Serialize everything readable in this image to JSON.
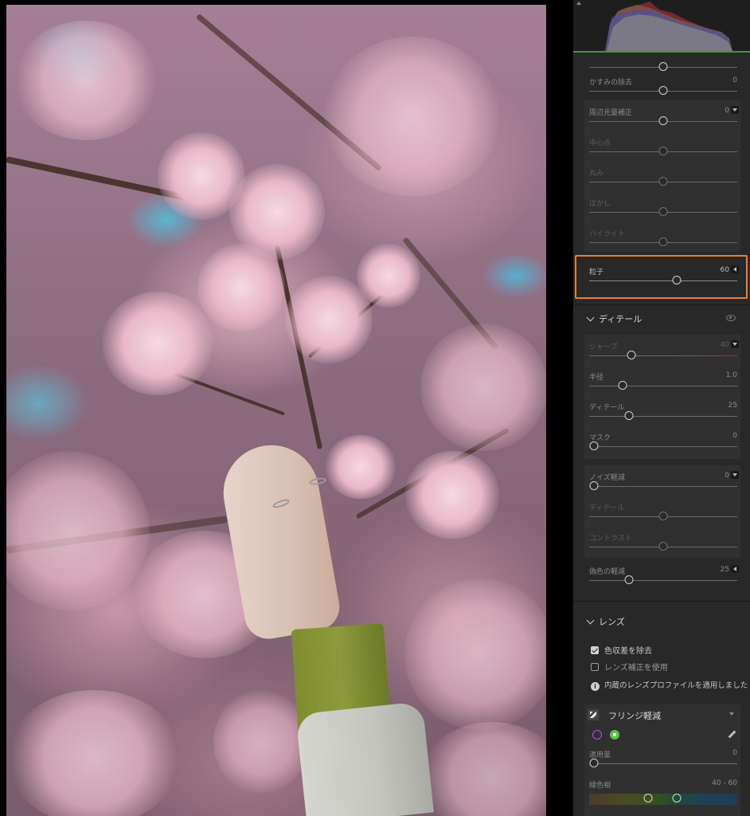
{
  "panel": {
    "sections": {
      "dehaze": {
        "label": "かすみの除去",
        "value": "0"
      },
      "vignette": {
        "label": "周辺光量補正",
        "value": "0",
        "sub": [
          {
            "label": "中心点"
          },
          {
            "label": "丸み"
          },
          {
            "label": "ぼかし"
          },
          {
            "label": "ハイライト"
          }
        ]
      },
      "grain": {
        "label": "粒子",
        "value": "60"
      },
      "detail": {
        "header": "ディテール",
        "sharpen": {
          "label": "シャープ",
          "value": "40"
        },
        "radius": {
          "label": "半径",
          "value": "1.0"
        },
        "detail": {
          "label": "ディテール",
          "value": "25"
        },
        "mask": {
          "label": "マスク",
          "value": "0"
        },
        "noise": {
          "label": "ノイズ軽減",
          "value": "0"
        },
        "noise_detail": {
          "label": "ディテール"
        },
        "noise_contrast": {
          "label": "コントラスト"
        },
        "color_noise": {
          "label": "偽色の軽減",
          "value": "25"
        }
      },
      "lens": {
        "header": "レンズ",
        "remove_ca": {
          "label": "色収差を除去",
          "checked": true
        },
        "use_profile": {
          "label": "レンズ補正を使用",
          "checked": false
        },
        "info": "内蔵のレンズプロファイルを適用しました",
        "fringe": {
          "header": "フリンジ軽減",
          "amount": {
            "label": "適用量",
            "value": "0"
          },
          "green_hue": {
            "label": "緑色相",
            "value": "40 - 60"
          }
        }
      }
    }
  },
  "colors": {
    "highlight": "#f07f24",
    "panel_bg": "#282828"
  }
}
